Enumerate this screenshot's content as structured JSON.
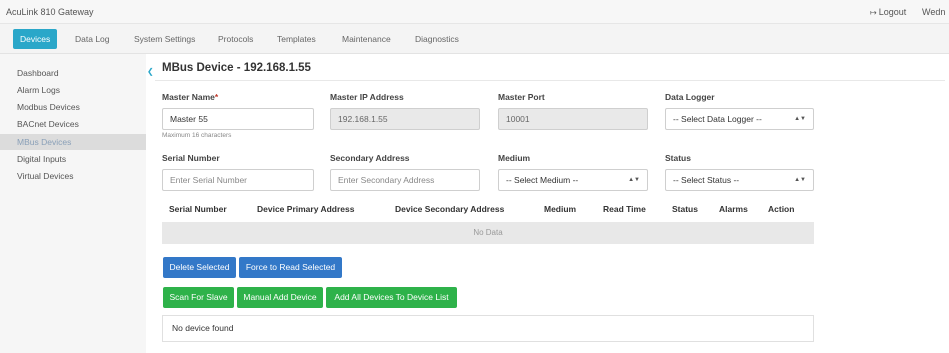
{
  "app": {
    "title": "AcuLink 810 Gateway",
    "logout_label": "Logout",
    "user_label": "Wedn"
  },
  "tabs": [
    {
      "label": "Devices",
      "active": true
    },
    {
      "label": "Data Log"
    },
    {
      "label": "System Settings"
    },
    {
      "label": "Protocols"
    },
    {
      "label": "Templates"
    },
    {
      "label": "Maintenance"
    },
    {
      "label": "Diagnostics"
    }
  ],
  "sidebar": {
    "items": [
      {
        "label": "Dashboard"
      },
      {
        "label": "Alarm Logs"
      },
      {
        "label": "Modbus Devices"
      },
      {
        "label": "BACnet Devices"
      },
      {
        "label": "MBus Devices",
        "active": true
      },
      {
        "label": "Digital Inputs"
      },
      {
        "label": "Virtual Devices"
      }
    ]
  },
  "page": {
    "title": "MBus Device - 192.168.1.55"
  },
  "form": {
    "master_name": {
      "label": "Master Name",
      "required_mark": "*",
      "value": "Master 55",
      "hint": "Maximum 16 characters"
    },
    "master_ip": {
      "label": "Master IP Address",
      "value": "192.168.1.55"
    },
    "master_port": {
      "label": "Master Port",
      "value": "10001"
    },
    "data_logger": {
      "label": "Data Logger",
      "selected": "-- Select Data Logger --"
    },
    "serial_number": {
      "label": "Serial Number",
      "placeholder": "Enter Serial Number"
    },
    "secondary_address": {
      "label": "Secondary Address",
      "placeholder": "Enter Secondary Address"
    },
    "medium": {
      "label": "Medium",
      "selected": "-- Select Medium --"
    },
    "status": {
      "label": "Status",
      "selected": "-- Select Status --"
    }
  },
  "table": {
    "columns": [
      "Serial Number",
      "Device Primary Address",
      "Device Secondary Address",
      "Medium",
      "Read Time",
      "Status",
      "Alarms",
      "Action"
    ],
    "empty_text": "No Data"
  },
  "buttons": {
    "delete_selected": "Delete Selected",
    "force_read": "Force to Read Selected",
    "scan_slave": "Scan For Slave",
    "manual_add": "Manual Add Device",
    "add_all": "Add All Devices To Device List"
  },
  "result_text": "No device found",
  "colors": {
    "accent": "#2aa7c9",
    "primary_button": "#3378c8",
    "success_button": "#2eb24a"
  }
}
